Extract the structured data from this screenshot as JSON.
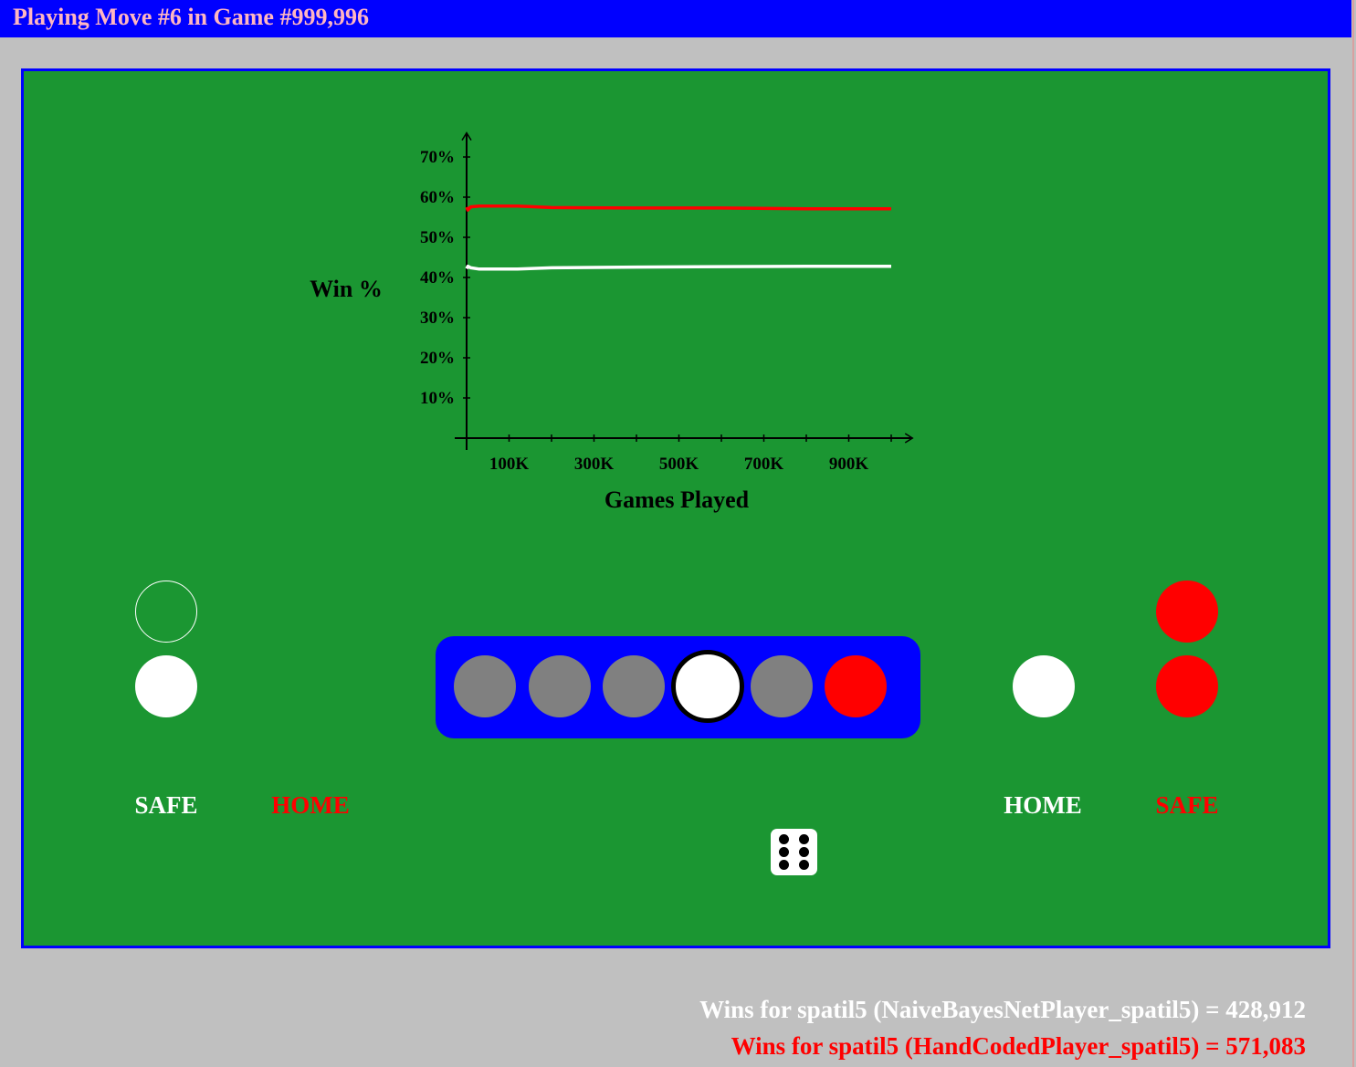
{
  "title": "Playing Move #6 in Game #999,996",
  "colors": {
    "background": "#c0c0c0",
    "title_bar": "#0000ff",
    "title_text": "#ffb6c1",
    "board": "#1b9632",
    "track": "#0000ff",
    "white_player": "#ffffff",
    "red_player": "#ff0000",
    "empty_cell": "#808080"
  },
  "chart_data": {
    "type": "line",
    "xlabel": "Games Played",
    "ylabel": "Win %",
    "xlim": [
      0,
      1050000
    ],
    "ylim": [
      0,
      76
    ],
    "y_ticks": [
      10,
      20,
      30,
      40,
      50,
      60,
      70
    ],
    "y_tick_labels": [
      "10%",
      "20%",
      "30%",
      "40%",
      "50%",
      "60%",
      "70%"
    ],
    "x_ticks": [
      100000,
      300000,
      500000,
      700000,
      900000
    ],
    "x_tick_labels": [
      "100K",
      "300K",
      "500K",
      "700K",
      "900K"
    ],
    "series": [
      {
        "color": "#ff0000",
        "x": [
          0,
          3000,
          10000,
          30000,
          60000,
          120000,
          200000,
          400000,
          600000,
          800000,
          1000000
        ],
        "y": [
          57.5,
          56.8,
          57.6,
          57.8,
          57.8,
          57.8,
          57.4,
          57.3,
          57.3,
          57.1,
          57.1
        ]
      },
      {
        "color": "#ffffff",
        "x": [
          0,
          3000,
          10000,
          30000,
          60000,
          120000,
          200000,
          400000,
          600000,
          800000,
          1000000
        ],
        "y": [
          42.2,
          42.8,
          42.4,
          42.1,
          42.1,
          42.1,
          42.4,
          42.6,
          42.7,
          42.8,
          42.8
        ]
      }
    ]
  },
  "board": {
    "left_safe_label": "SAFE",
    "left_home_label": "HOME",
    "right_home_label": "HOME",
    "right_safe_label": "SAFE",
    "track": [
      "empty",
      "empty",
      "empty",
      "white",
      "empty",
      "red"
    ],
    "selected_cell": 3,
    "die_value": 6
  },
  "stats": {
    "white_wins": "Wins for spatil5 (NaiveBayesNetPlayer_spatil5) = 428,912",
    "red_wins": "Wins for spatil5 (HandCodedPlayer_spatil5) = 571,083"
  }
}
